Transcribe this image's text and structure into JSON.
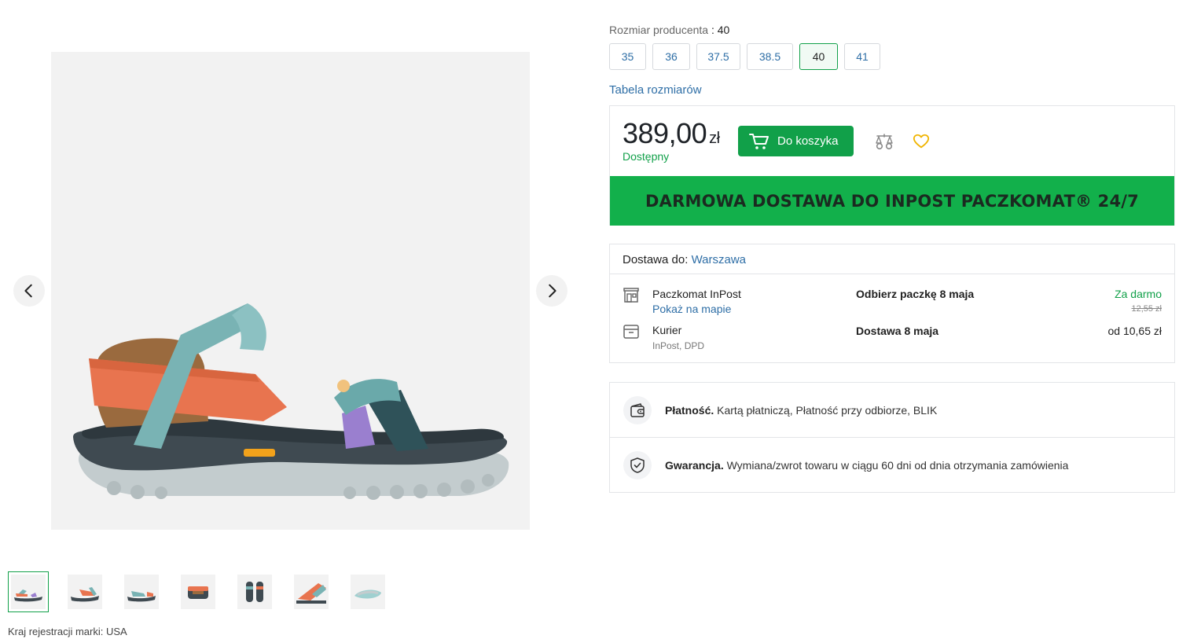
{
  "product": {
    "brand_country_label": "Kraj rejestracji marki: USA"
  },
  "gallery": {
    "prev_icon": "chevron-left-icon",
    "next_icon": "chevron-right-icon",
    "thumbnails_count": 7
  },
  "size_selector": {
    "label": "Rozmiar producenta",
    "separator": " : ",
    "selected": "40",
    "options": [
      "35",
      "36",
      "37.5",
      "38.5",
      "40",
      "41"
    ],
    "size_chart_link": "Tabela rozmiarów"
  },
  "buy_box": {
    "price": "389,00",
    "currency": "zł",
    "availability": "Dostępny",
    "cart_button": "Do koszyka",
    "promo_banner": "DARMOWA DOSTAWA DO INPOST PACZKOMAT® 24/7"
  },
  "delivery": {
    "header_label": "Dostawa do:",
    "city": "Warszawa",
    "options": [
      {
        "icon": "parcel-locker-icon",
        "name": "Paczkomat InPost",
        "sub": "Pokaż na mapie",
        "date": "Odbierz paczkę 8 maja",
        "price": "Za darmo",
        "old_price": "12,55 zł"
      },
      {
        "icon": "courier-box-icon",
        "name": "Kurier",
        "sub": "InPost, DPD",
        "date": "Dostawa 8 maja",
        "price": "od 10,65 zł"
      }
    ]
  },
  "info": {
    "payment": {
      "title": "Płatność.",
      "text": " Kartą płatniczą, Płatność przy odbiorze, BLIK"
    },
    "warranty": {
      "title": "Gwarancja.",
      "text": " Wymiana/zwrot towaru w ciągu 60 dni od dnia otrzymania zamówienia"
    }
  },
  "colors": {
    "accent_green": "#11a049",
    "promo_green": "#12b04b",
    "link_blue": "#2e6ea6",
    "heart_yellow": "#f0b400"
  }
}
